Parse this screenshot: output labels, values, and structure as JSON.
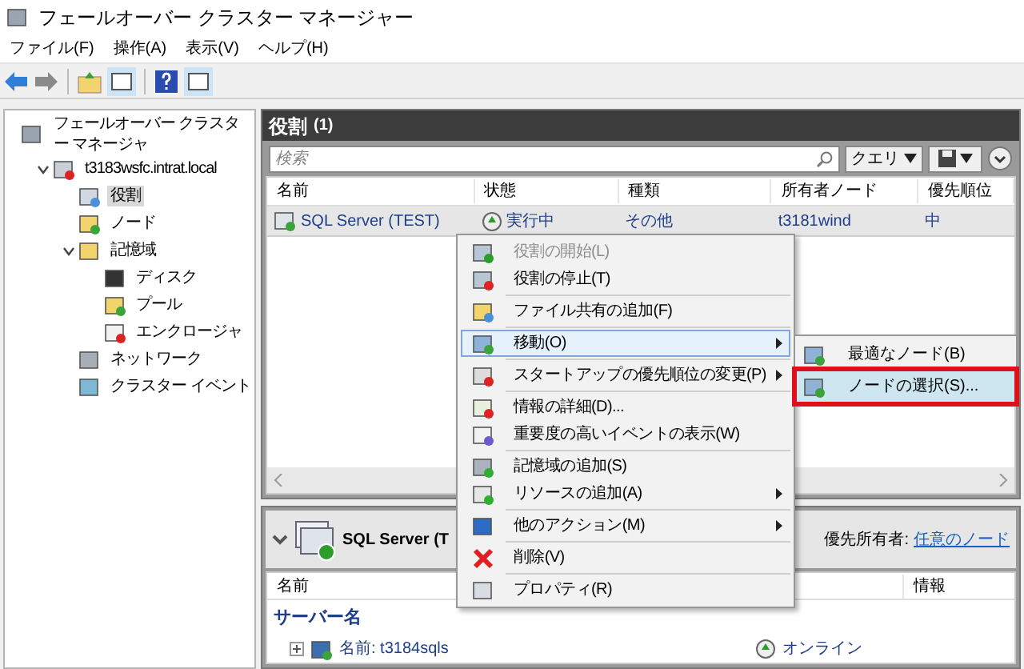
{
  "window": {
    "title": "フェールオーバー クラスター マネージャー"
  },
  "menu_bar": [
    "ファイル(F)",
    "操作(A)",
    "表示(V)",
    "ヘルプ(H)"
  ],
  "tree": [
    {
      "label": "フェールオーバー クラスター マネージャ",
      "selected": false,
      "children": [
        {
          "label": "t3183wsfc.intrat.local",
          "selected": false,
          "expanded": true,
          "children": [
            {
              "label": "役割",
              "selected": true
            },
            {
              "label": "ノード",
              "selected": false
            },
            {
              "label": "記憶域",
              "selected": false,
              "expanded": true,
              "children": [
                {
                  "label": "ディスク",
                  "selected": false
                },
                {
                  "label": "プール",
                  "selected": false
                },
                {
                  "label": "エンクロージャ",
                  "selected": false
                }
              ]
            },
            {
              "label": "ネットワーク",
              "selected": false
            },
            {
              "label": "クラスター イベント",
              "selected": false
            }
          ]
        }
      ]
    }
  ],
  "roles_panel": {
    "title": "役割",
    "count": "(1)",
    "search": {
      "placeholder": "検索"
    },
    "query_button": "クエリ",
    "columns": [
      "名前",
      "状態",
      "種類",
      "所有者ノード",
      "優先順位"
    ],
    "rows": [
      {
        "name": "SQL Server (TEST)",
        "status": "実行中",
        "type": "その他",
        "owner": "t3181wind",
        "priority": "中",
        "selected": true
      }
    ]
  },
  "detail_panel": {
    "title": "SQL Server (T",
    "preferred_owners_label": "優先所有者:",
    "preferred_owners_link": "任意のノード",
    "columns": [
      "名前",
      "情報"
    ],
    "group": "サーバー名",
    "rows": [
      {
        "name": "名前: t3184sqls",
        "status": "オンライン"
      }
    ]
  },
  "context_menu": [
    {
      "kind": "item",
      "label": "役割の開始(L)",
      "disabled": true,
      "submenu": false,
      "highlighted": false
    },
    {
      "kind": "item",
      "label": "役割の停止(T)",
      "disabled": false,
      "submenu": false,
      "highlighted": false
    },
    {
      "kind": "separator"
    },
    {
      "kind": "item",
      "label": "ファイル共有の追加(F)",
      "disabled": false,
      "submenu": false,
      "highlighted": false
    },
    {
      "kind": "separator"
    },
    {
      "kind": "item",
      "label": "移動(O)",
      "disabled": false,
      "submenu": true,
      "highlighted": true
    },
    {
      "kind": "separator"
    },
    {
      "kind": "item",
      "label": "スタートアップの優先順位の変更(P)",
      "disabled": false,
      "submenu": true,
      "highlighted": false
    },
    {
      "kind": "separator"
    },
    {
      "kind": "item",
      "label": "情報の詳細(D)...",
      "disabled": false,
      "submenu": false,
      "highlighted": false
    },
    {
      "kind": "item",
      "label": "重要度の高いイベントの表示(W)",
      "disabled": false,
      "submenu": false,
      "highlighted": false
    },
    {
      "kind": "separator"
    },
    {
      "kind": "item",
      "label": "記憶域の追加(S)",
      "disabled": false,
      "submenu": false,
      "highlighted": false
    },
    {
      "kind": "item",
      "label": "リソースの追加(A)",
      "disabled": false,
      "submenu": true,
      "highlighted": false
    },
    {
      "kind": "separator"
    },
    {
      "kind": "item",
      "label": "他のアクション(M)",
      "disabled": false,
      "submenu": true,
      "highlighted": false
    },
    {
      "kind": "separator"
    },
    {
      "kind": "item",
      "label": "削除(V)",
      "disabled": false,
      "submenu": false,
      "highlighted": false
    },
    {
      "kind": "separator"
    },
    {
      "kind": "item",
      "label": "プロパティ(R)",
      "disabled": false,
      "submenu": false,
      "highlighted": false
    }
  ],
  "submenu": [
    {
      "label": "最適なノード(B)",
      "selected": false
    },
    {
      "label": "ノードの選択(S)...",
      "selected": true
    }
  ]
}
